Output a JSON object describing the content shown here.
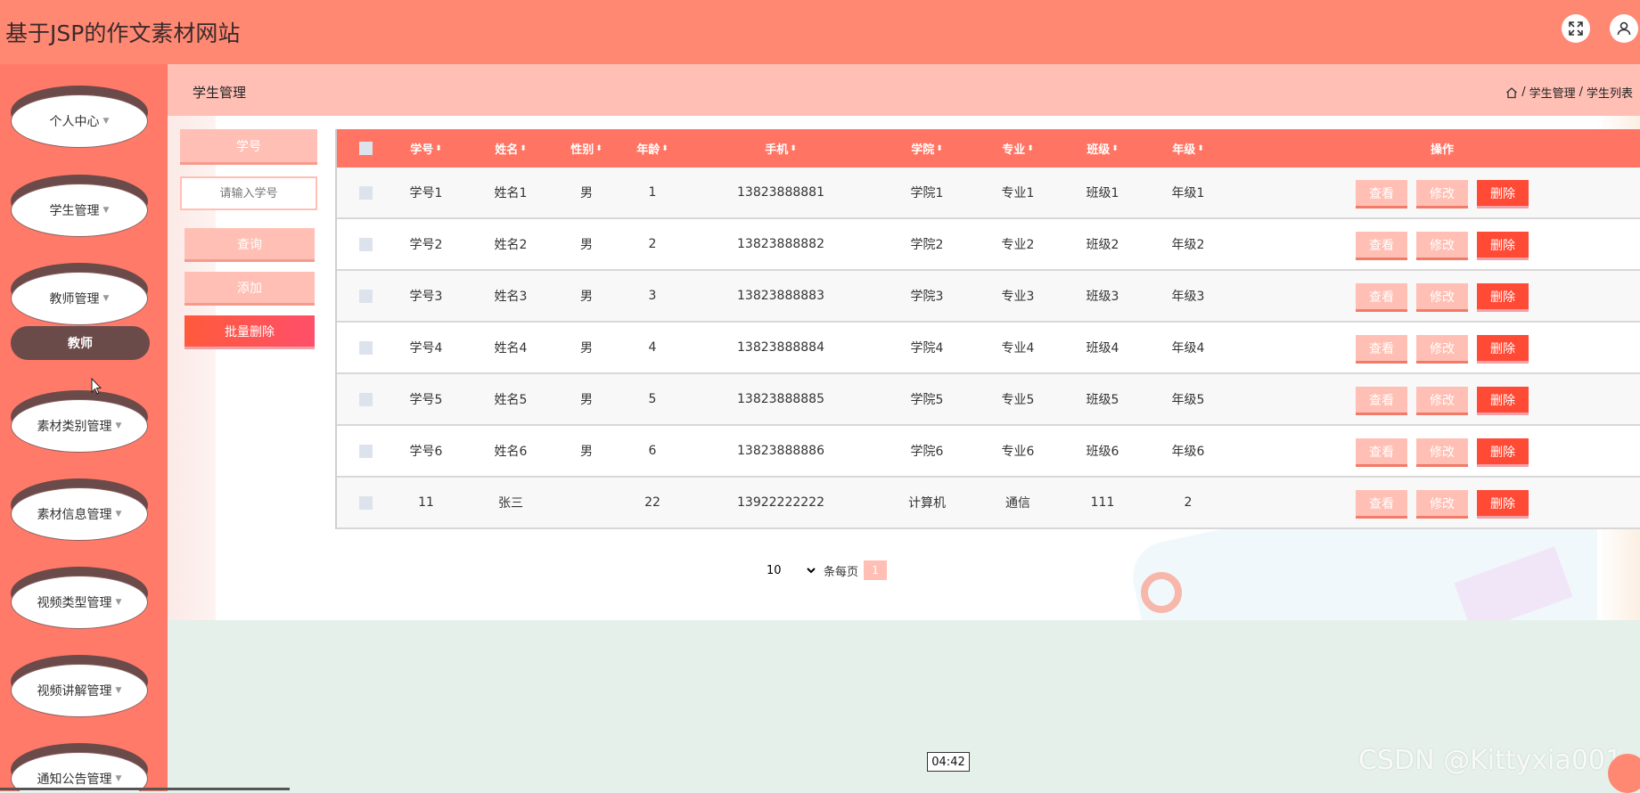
{
  "app": {
    "title": "基于JSP的作文素材网站"
  },
  "header": {
    "fullscreen_icon": "expand-arrows-icon",
    "user_icon": "user-icon"
  },
  "sidebar": {
    "items": [
      {
        "label": "个人中心"
      },
      {
        "label": "学生管理"
      },
      {
        "label": "教师管理"
      },
      {
        "label": "素材类别管理"
      },
      {
        "label": "素材信息管理"
      },
      {
        "label": "视频类型管理"
      },
      {
        "label": "视频讲解管理"
      },
      {
        "label": "通知公告管理"
      }
    ],
    "sub_item": "教师"
  },
  "page": {
    "title": "学生管理",
    "breadcrumb": [
      "学生管理",
      "学生列表"
    ],
    "separator": "/"
  },
  "search": {
    "label": "学号",
    "placeholder": "请输入学号",
    "query_button": "查询",
    "add_button": "添加",
    "batch_delete_button": "批量删除"
  },
  "table": {
    "columns": [
      "学号",
      "姓名",
      "性别",
      "年龄",
      "手机",
      "学院",
      "专业",
      "班级",
      "年级",
      "操作"
    ],
    "rows": [
      [
        "学号1",
        "姓名1",
        "男",
        "1",
        "13823888881",
        "学院1",
        "专业1",
        "班级1",
        "年级1"
      ],
      [
        "学号2",
        "姓名2",
        "男",
        "2",
        "13823888882",
        "学院2",
        "专业2",
        "班级2",
        "年级2"
      ],
      [
        "学号3",
        "姓名3",
        "男",
        "3",
        "13823888883",
        "学院3",
        "专业3",
        "班级3",
        "年级3"
      ],
      [
        "学号4",
        "姓名4",
        "男",
        "4",
        "13823888884",
        "学院4",
        "专业4",
        "班级4",
        "年级4"
      ],
      [
        "学号5",
        "姓名5",
        "男",
        "5",
        "13823888885",
        "学院5",
        "专业5",
        "班级5",
        "年级5"
      ],
      [
        "学号6",
        "姓名6",
        "男",
        "6",
        "13823888886",
        "学院6",
        "专业6",
        "班级6",
        "年级6"
      ],
      [
        "11",
        "张三",
        "",
        "22",
        "13922222222",
        "计算机",
        "通信",
        "111",
        "2"
      ]
    ],
    "actions": {
      "view": "查看",
      "edit": "修改",
      "delete": "删除"
    }
  },
  "pagination": {
    "page_size": "10",
    "per_page_label": "条每页",
    "current_page": "1"
  },
  "overlay": {
    "timer": "04:42",
    "watermark": "CSDN @Kittyxia001"
  },
  "colors": {
    "header": "#ff8873",
    "sidebar": "#ff7a68",
    "accent_light": "#ffbfb4",
    "danger": "#ff4a36",
    "table_head": "#ff7462"
  }
}
